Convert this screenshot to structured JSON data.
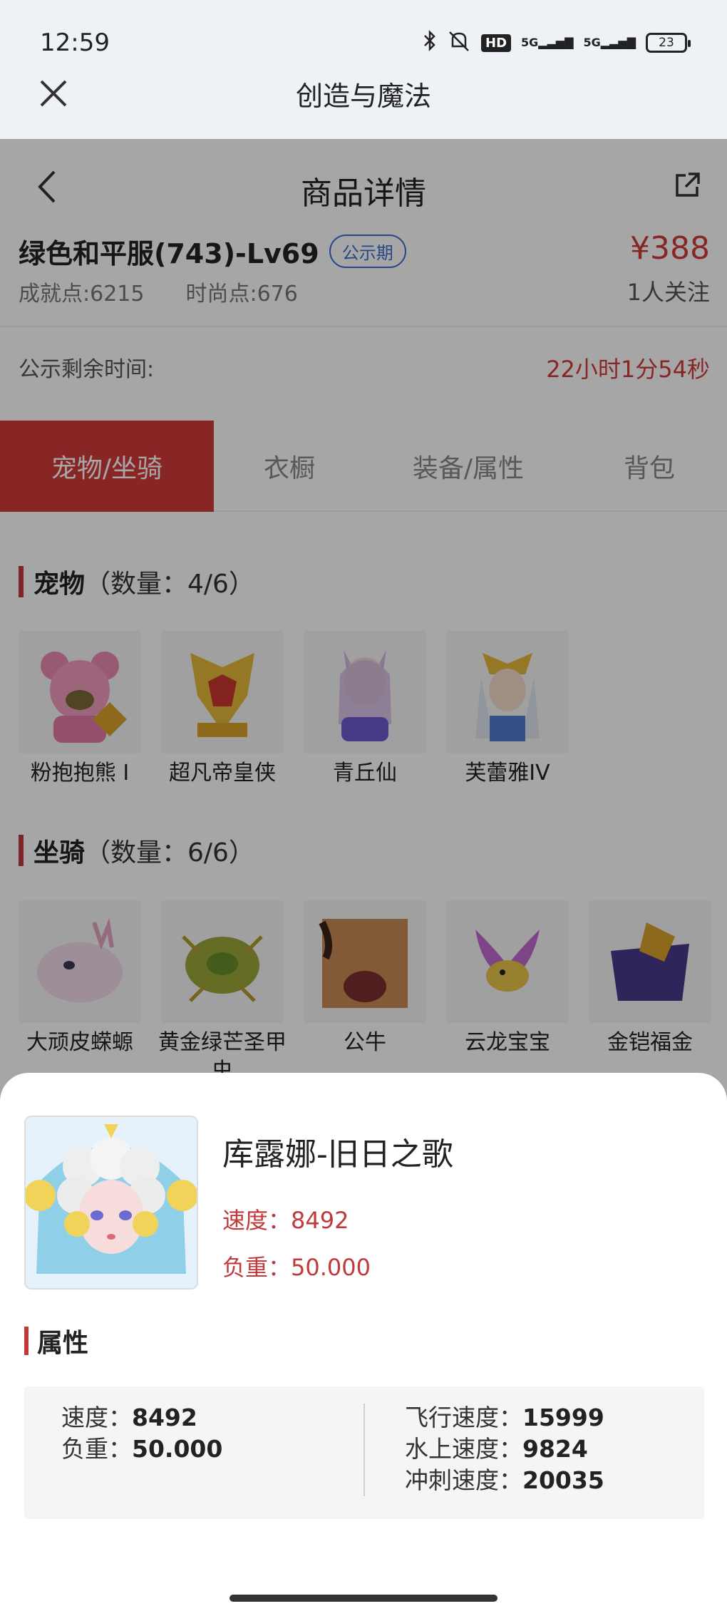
{
  "status": {
    "time": "12:59",
    "hd": "HD",
    "net1": "5G",
    "net2": "5G",
    "battery": "23"
  },
  "app": {
    "title": "创造与魔法"
  },
  "nav": {
    "title": "商品详情"
  },
  "product": {
    "title": "绿色和平服(743)-Lv69",
    "tag": "公示期",
    "price": "¥388",
    "achievement": "成就点:6215",
    "fashion": "时尚点:676",
    "followers": "1人关注",
    "remain_label": "公示剩余时间:",
    "remain_value": "22小时1分54秒"
  },
  "tabs": [
    "宠物/坐骑",
    "衣橱",
    "装备/属性",
    "背包"
  ],
  "pets": {
    "heading": "宠物",
    "count": "（数量：4/6）",
    "items": [
      "粉抱抱熊 I",
      "超凡帝皇侠",
      "青丘仙",
      "芙蕾雅IV"
    ]
  },
  "mounts": {
    "heading": "坐骑",
    "count": "（数量：6/6）",
    "items": [
      "大顽皮蝾螈",
      "黄金绿芒圣甲虫",
      "公牛",
      "云龙宝宝",
      "金铠福金"
    ]
  },
  "sheet": {
    "name": "库露娜-旧日之歌",
    "speed_line": "速度：8492",
    "load_line": "负重：50.000",
    "attr_heading": "属性",
    "attrs_left": [
      {
        "label": "速度：",
        "value": "8492"
      },
      {
        "label": "负重：",
        "value": "50.000"
      }
    ],
    "attrs_right": [
      {
        "label": "飞行速度：",
        "value": "15999"
      },
      {
        "label": "水上速度：",
        "value": "9824"
      },
      {
        "label": "冲刺速度：",
        "value": "20035"
      }
    ]
  },
  "colors": {
    "accent": "#d23b3b",
    "tag_blue": "#3b6fd0"
  }
}
